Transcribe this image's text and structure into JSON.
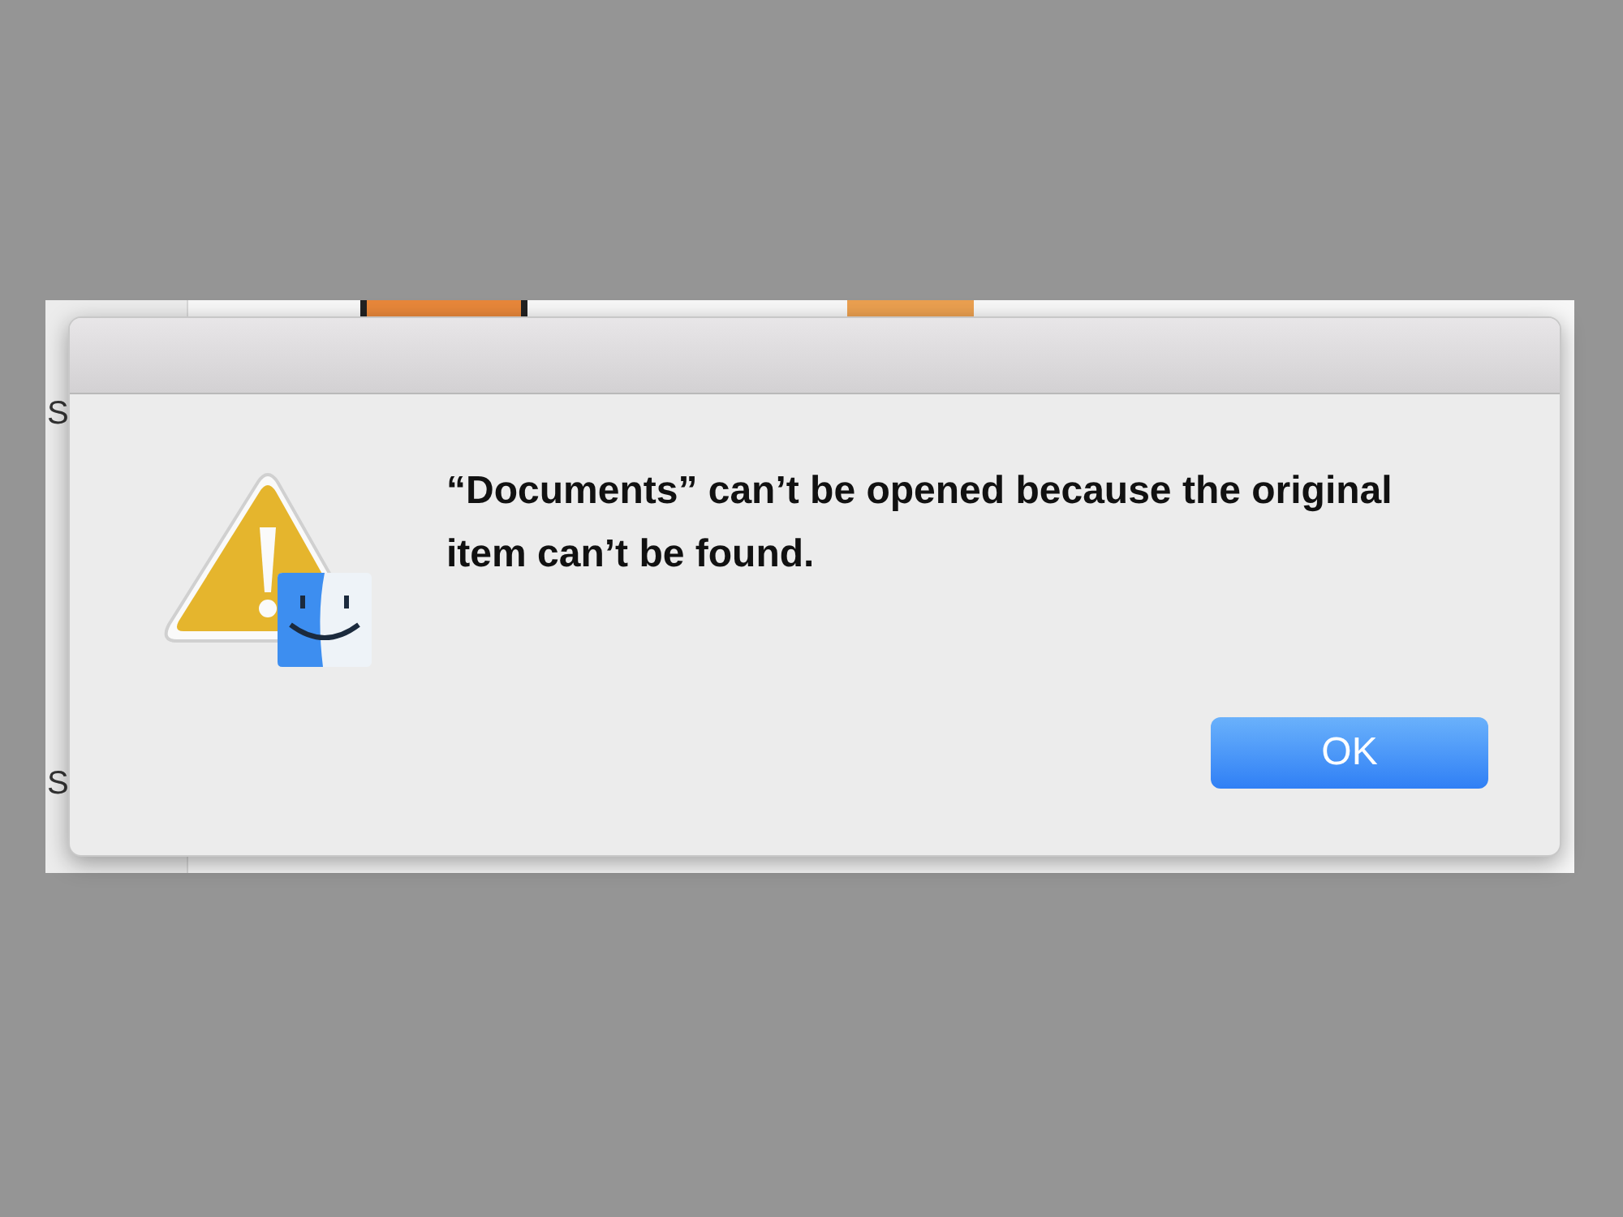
{
  "background_window": {
    "side_labels": [
      "S",
      "S"
    ]
  },
  "dialog": {
    "message": "“Documents” can’t be opened because the original item can’t be found.",
    "buttons": [
      {
        "label": "OK",
        "default": true
      }
    ]
  }
}
